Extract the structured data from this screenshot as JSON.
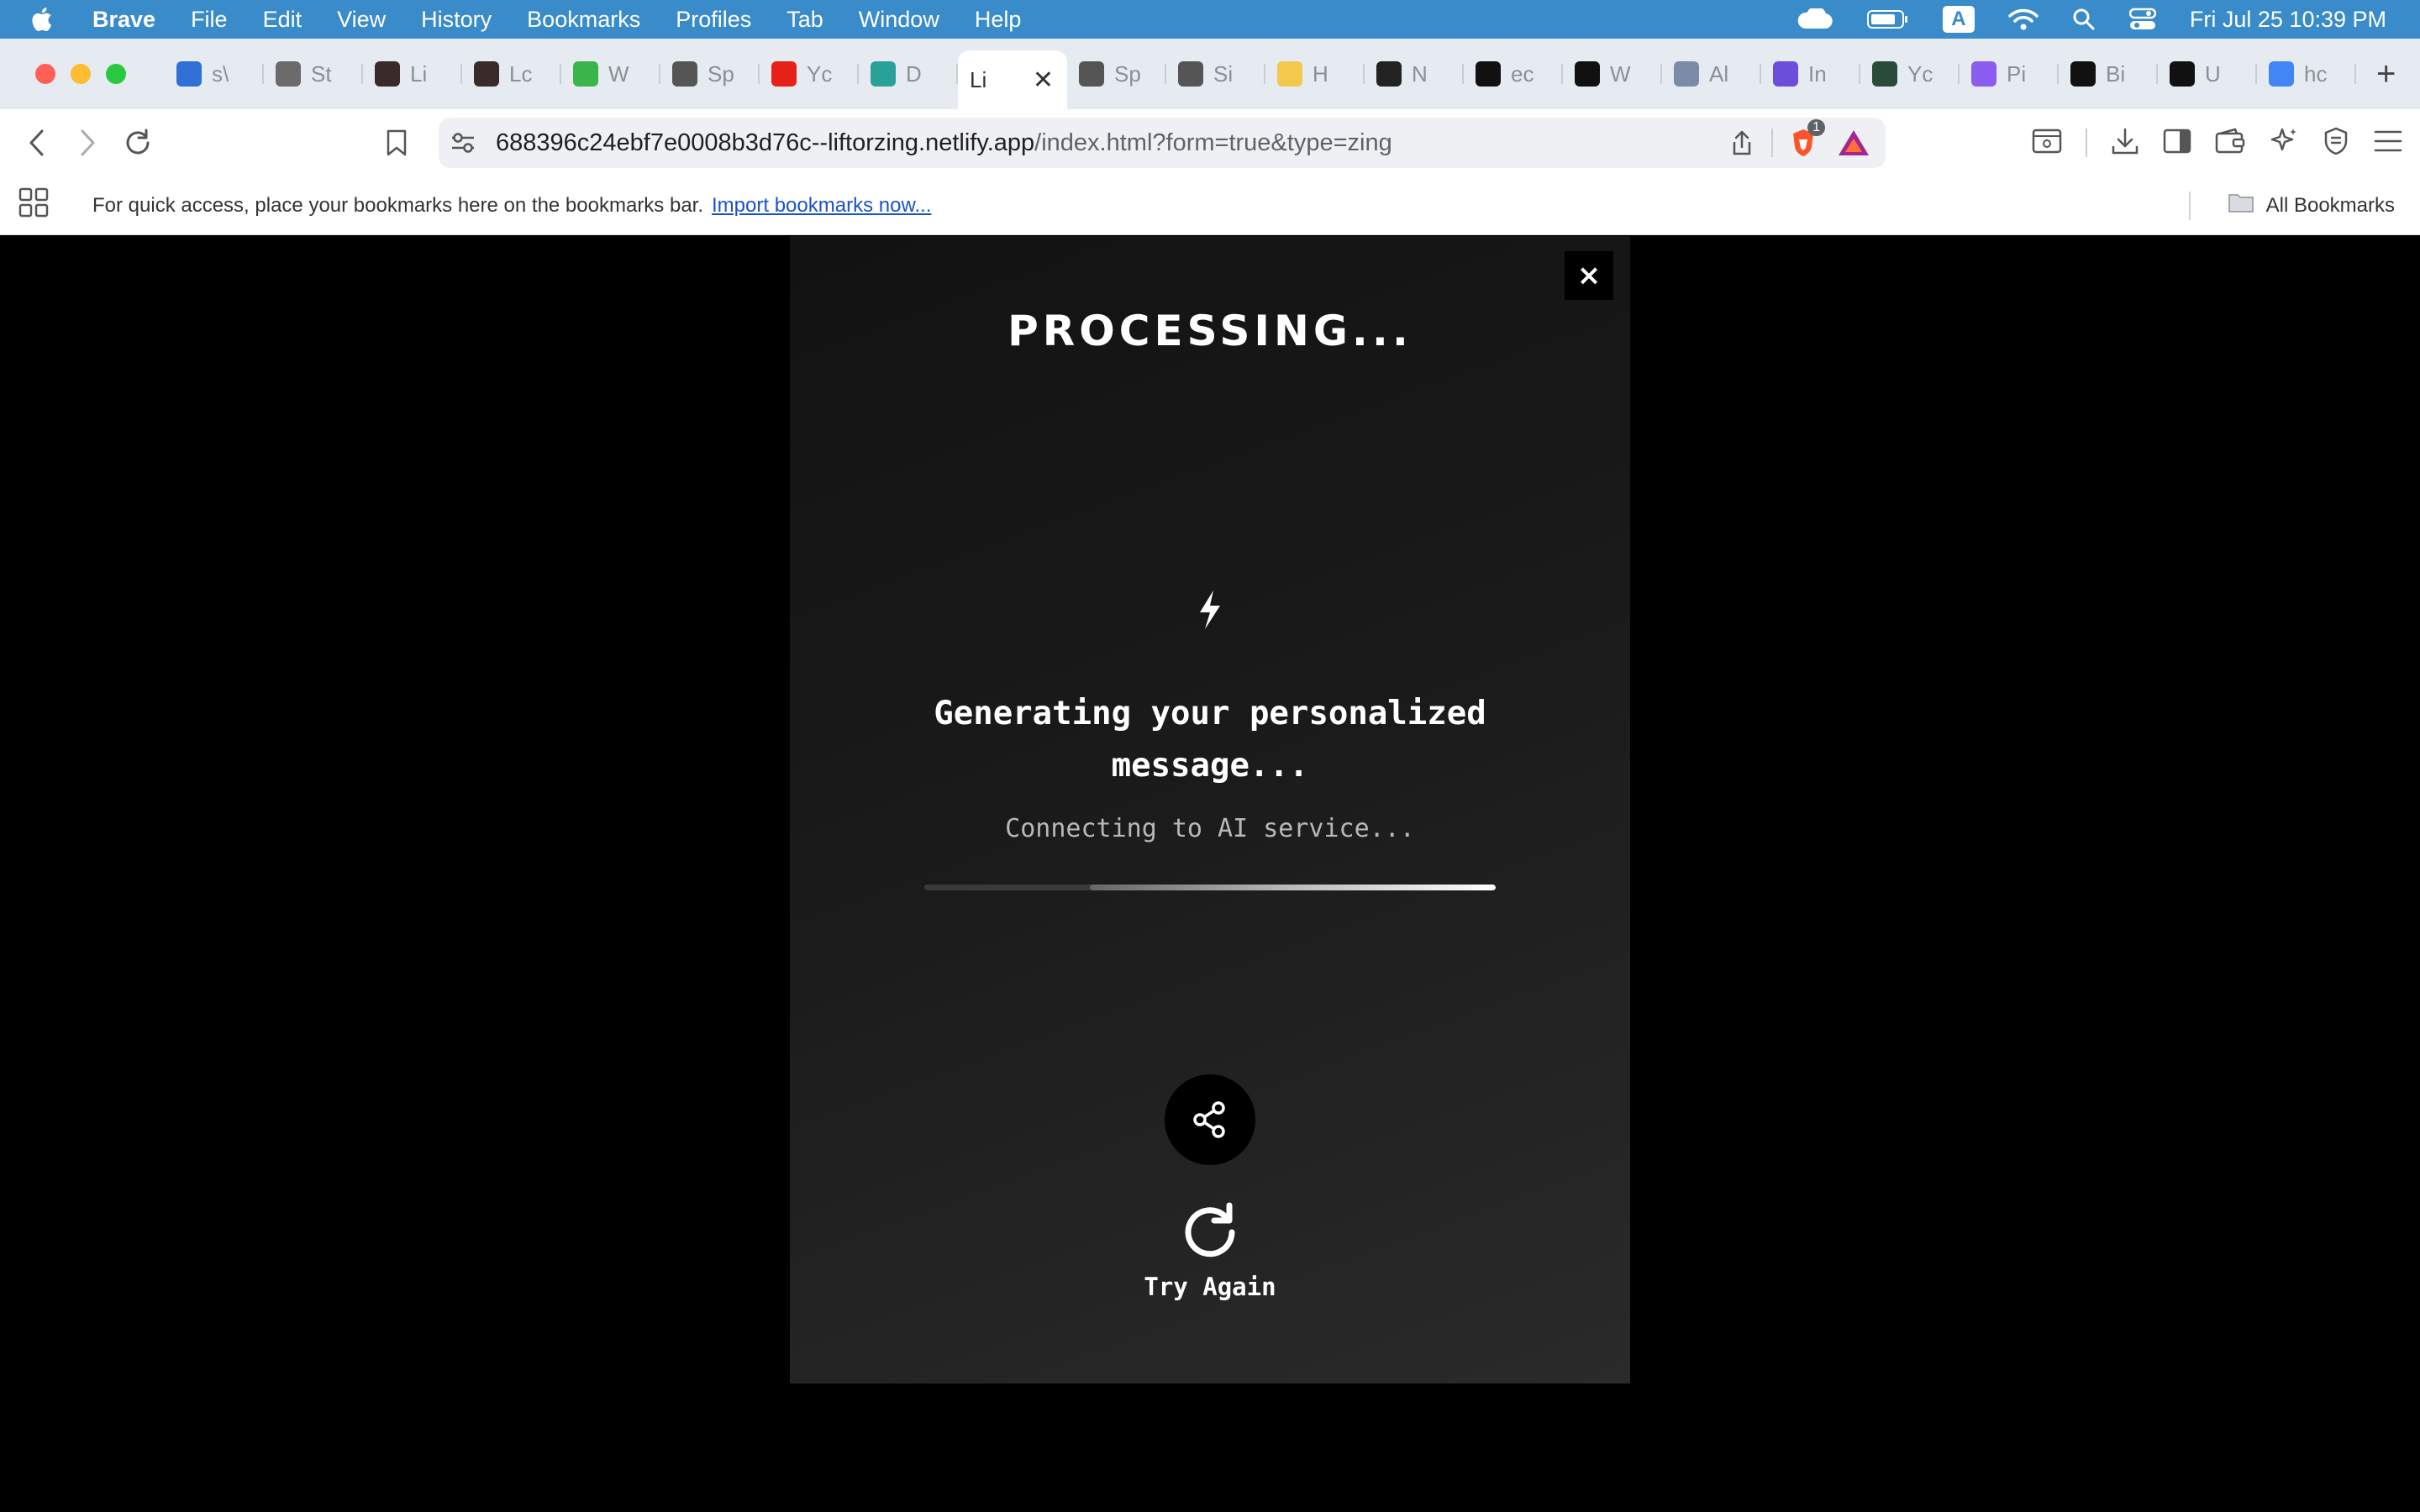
{
  "menubar": {
    "app_name": "Brave",
    "menus": [
      "File",
      "Edit",
      "View",
      "History",
      "Bookmarks",
      "Profiles",
      "Tab",
      "Window",
      "Help"
    ],
    "input_badge": "A",
    "clock": "Fri Jul 25  10:39 PM"
  },
  "tabs": [
    {
      "label": "s\\",
      "favicon_color": "#2f6fd6"
    },
    {
      "label": "St",
      "favicon_color": "#6b6b6b"
    },
    {
      "label": "Li",
      "favicon_color": "#3a2a2a"
    },
    {
      "label": "Lc",
      "favicon_color": "#3a2a2a"
    },
    {
      "label": "W",
      "favicon_color": "#3bb54a"
    },
    {
      "label": "Sp",
      "favicon_color": "#555"
    },
    {
      "label": "Yc",
      "favicon_color": "#e62117"
    },
    {
      "label": "D",
      "favicon_color": "#2aa198"
    },
    {
      "label": "Li",
      "favicon_color": "#ffffff",
      "active": true
    },
    {
      "label": "Sp",
      "favicon_color": "#555"
    },
    {
      "label": "Si",
      "favicon_color": "#555"
    },
    {
      "label": "H",
      "favicon_color": "#f2c94c"
    },
    {
      "label": "N",
      "favicon_color": "#222"
    },
    {
      "label": "ec",
      "favicon_color": "#111"
    },
    {
      "label": "W",
      "favicon_color": "#111"
    },
    {
      "label": "Al",
      "favicon_color": "#7a8ca8"
    },
    {
      "label": "In",
      "favicon_color": "#6b4fd8"
    },
    {
      "label": "Yc",
      "favicon_color": "#2a4a3a"
    },
    {
      "label": "Pi",
      "favicon_color": "#8a5cf0"
    },
    {
      "label": "Bi",
      "favicon_color": "#111"
    },
    {
      "label": "U",
      "favicon_color": "#111"
    },
    {
      "label": "hc",
      "favicon_color": "#4285f4"
    }
  ],
  "toolbar": {
    "url_host": "688396c24ebf7e0008b3d76c--liftorzing.netlify.app",
    "url_path": "/index.html?form=true&type=zing",
    "shields_count": "1"
  },
  "bookmarks_bar": {
    "hint": "For quick access, place your bookmarks here on the bookmarks bar.",
    "import_link": "Import bookmarks now...",
    "all_bookmarks": "All Bookmarks"
  },
  "modal": {
    "close_symbol": "×",
    "title": "PROCESSING...",
    "message": "Generating your personalized message...",
    "status": "Connecting to AI service...",
    "progress_start": 0.29,
    "progress_end": 1.0,
    "retry_label": "Try Again"
  }
}
